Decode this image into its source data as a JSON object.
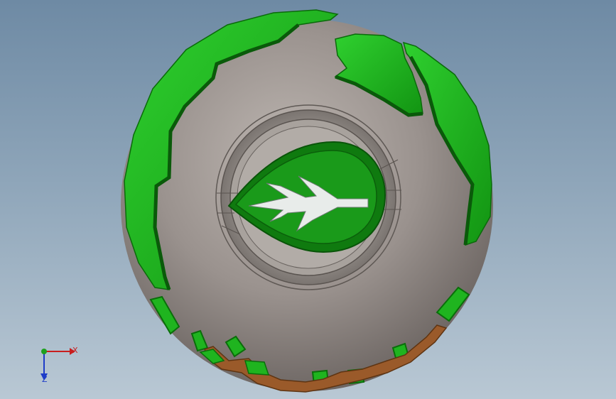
{
  "viewport": {
    "background_top": "#6e8aa4",
    "background_bottom": "#b9c8d4"
  },
  "model": {
    "description_icon": "globe-bottle-cap-icon",
    "colors": {
      "body_grey": "#8c8480",
      "continent_green": "#1fb41f",
      "continent_dark_green": "#0a6e0a",
      "base_brown": "#9a5a2a",
      "emblem_green": "#158c15",
      "arrow_white": "#e8ecea"
    }
  },
  "triad": {
    "x_label": "X",
    "z_label": "Z",
    "x_color": "#c81e1e",
    "y_color": "#1ea01e",
    "z_color": "#1e3cc8"
  }
}
